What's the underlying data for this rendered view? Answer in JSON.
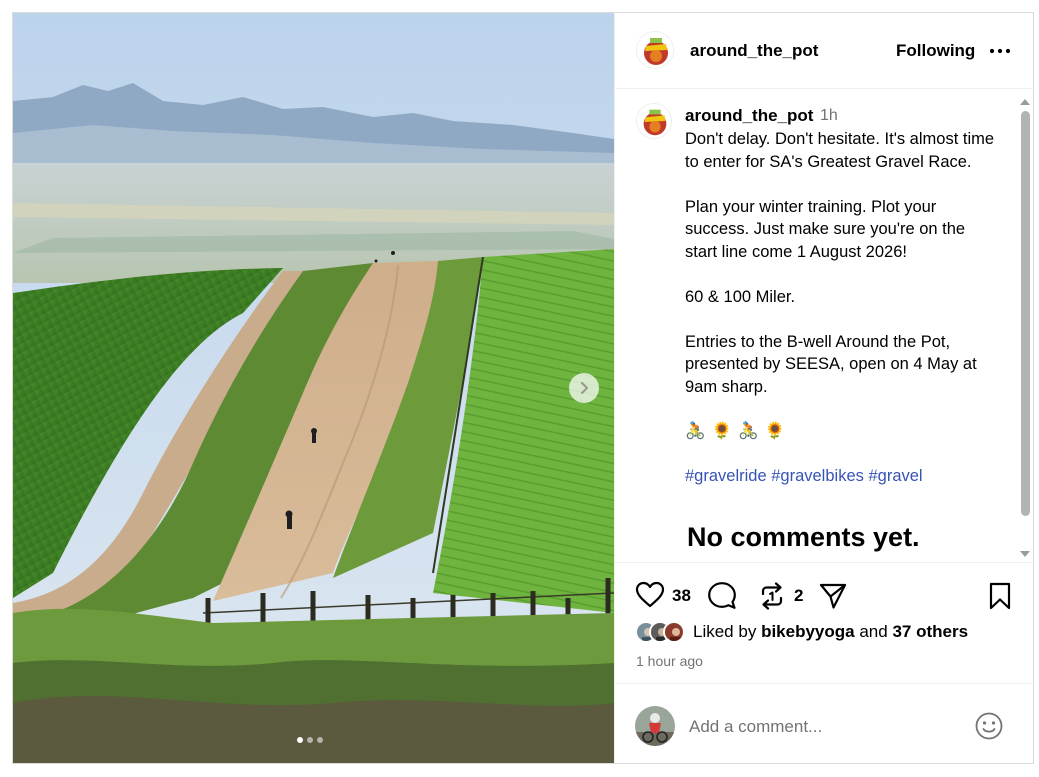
{
  "post": {
    "username": "around_the_pot",
    "follow_label": "Following",
    "more_icon": "more-horizontal-icon",
    "media": {
      "image_description_icon": "gravel-road-photo",
      "next_icon": "chevron-right-icon",
      "slide_count": 3,
      "active_slide": 1
    },
    "caption": {
      "username": "around_the_pot",
      "time": "1h",
      "paragraphs": [
        "Don't delay. Don't hesitate. It's almost time to enter for SA's Greatest Gravel Race.",
        "Plan your winter training. Plot your success. Just make sure you're on the start line come 1 August 2026!",
        "60 & 100 Miler.",
        "Entries to the B-well Around the Pot, presented by SEESA, open on 4 May at 9am sharp."
      ],
      "emojis": [
        "🚴",
        "🌻",
        "🚴",
        "🌻"
      ],
      "hashtags": [
        "#gravelride",
        "#gravelbikes",
        "#gravel"
      ]
    },
    "no_comments_text": "No comments yet.",
    "actions": {
      "like_icon": "heart-icon",
      "like_count": "38",
      "comment_icon": "comment-icon",
      "repost_icon": "repost-icon",
      "repost_count": "2",
      "share_icon": "send-icon",
      "save_icon": "bookmark-icon"
    },
    "liked_by": {
      "prefix": "Liked by",
      "user": "bikebyyoga",
      "connector": "and",
      "others": "37 others"
    },
    "time_ago": "1 hour ago",
    "comment": {
      "placeholder": "Add a comment...",
      "emoji_icon": "smiley-icon"
    }
  }
}
